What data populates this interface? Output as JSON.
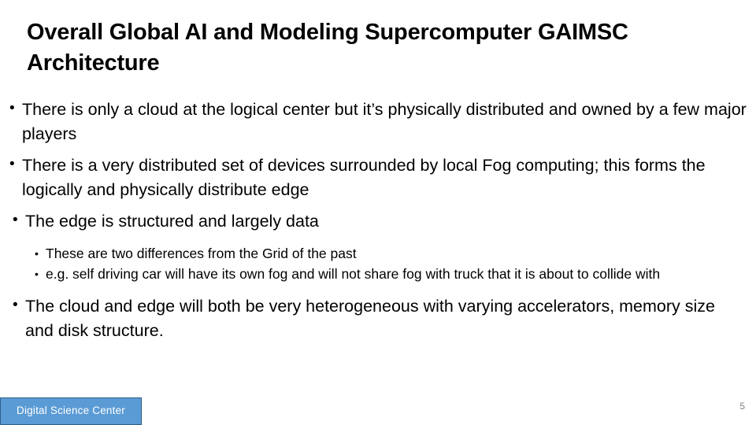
{
  "slide": {
    "title": "Overall Global AI and Modeling Supercomputer GAIMSC Architecture",
    "bullet_marker": "•",
    "body": [
      {
        "level": 1,
        "text": "There is only a cloud at the logical center but it’s physically distributed and owned by a few major players"
      },
      {
        "level": 1,
        "text": "There is a very distributed set of devices surrounded by local Fog computing; this forms the logically and physically distribute edge"
      },
      {
        "level": 1,
        "text": "The edge is structured and largely data"
      },
      {
        "level": 2,
        "text": "These are two differences from the Grid of the past"
      },
      {
        "level": 2,
        "text": "e.g. self driving car will have its own fog and will not share fog with truck that it is about to collide with"
      },
      {
        "level": 1,
        "text": "The cloud and edge will both be very heterogeneous with varying accelerators, memory size and disk structure."
      }
    ],
    "footer": {
      "badge_label": "Digital Science Center",
      "badge_fill_color": "#5B9BD5",
      "badge_border_color": "#2E5F8A",
      "badge_text_color": "#FFFFFF"
    },
    "page_number": "5"
  }
}
